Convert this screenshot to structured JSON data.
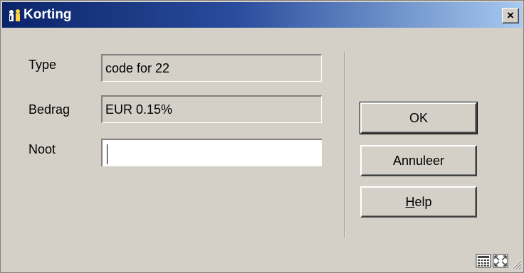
{
  "window": {
    "title": "Korting",
    "close_label": "×"
  },
  "form": {
    "type_label": "Type",
    "type_value": "code for 22",
    "amount_label": "Bedrag",
    "amount_value": "EUR 0.15%",
    "note_label": "Noot",
    "note_value": ""
  },
  "buttons": {
    "ok": "OK",
    "cancel": "Annuleer",
    "help_mnemonic": "H",
    "help_rest": "elp"
  },
  "statusbar": {
    "icons": [
      "calculator-icon",
      "expand-icon",
      "resize-grip-icon"
    ]
  }
}
